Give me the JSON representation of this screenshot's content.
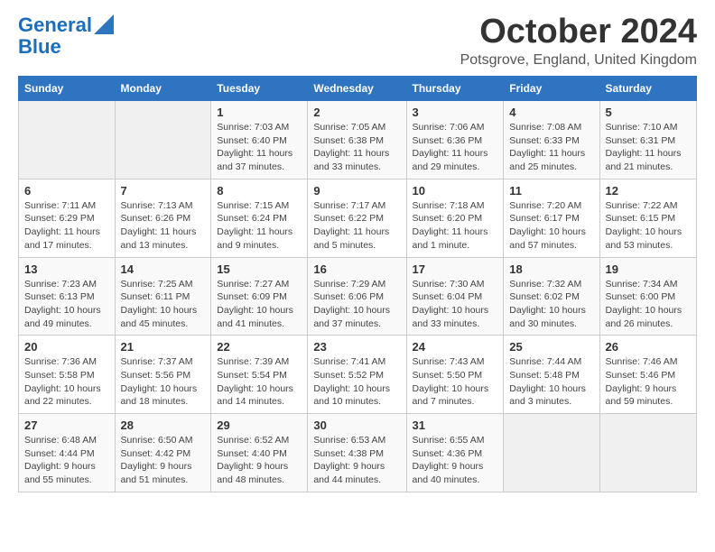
{
  "logo": {
    "line1": "General",
    "line2": "Blue"
  },
  "header": {
    "month_title": "October 2024",
    "location": "Potsgrove, England, United Kingdom"
  },
  "days_of_week": [
    "Sunday",
    "Monday",
    "Tuesday",
    "Wednesday",
    "Thursday",
    "Friday",
    "Saturday"
  ],
  "weeks": [
    [
      {
        "day": "",
        "info": ""
      },
      {
        "day": "",
        "info": ""
      },
      {
        "day": "1",
        "info": "Sunrise: 7:03 AM\nSunset: 6:40 PM\nDaylight: 11 hours and 37 minutes."
      },
      {
        "day": "2",
        "info": "Sunrise: 7:05 AM\nSunset: 6:38 PM\nDaylight: 11 hours and 33 minutes."
      },
      {
        "day": "3",
        "info": "Sunrise: 7:06 AM\nSunset: 6:36 PM\nDaylight: 11 hours and 29 minutes."
      },
      {
        "day": "4",
        "info": "Sunrise: 7:08 AM\nSunset: 6:33 PM\nDaylight: 11 hours and 25 minutes."
      },
      {
        "day": "5",
        "info": "Sunrise: 7:10 AM\nSunset: 6:31 PM\nDaylight: 11 hours and 21 minutes."
      }
    ],
    [
      {
        "day": "6",
        "info": "Sunrise: 7:11 AM\nSunset: 6:29 PM\nDaylight: 11 hours and 17 minutes."
      },
      {
        "day": "7",
        "info": "Sunrise: 7:13 AM\nSunset: 6:26 PM\nDaylight: 11 hours and 13 minutes."
      },
      {
        "day": "8",
        "info": "Sunrise: 7:15 AM\nSunset: 6:24 PM\nDaylight: 11 hours and 9 minutes."
      },
      {
        "day": "9",
        "info": "Sunrise: 7:17 AM\nSunset: 6:22 PM\nDaylight: 11 hours and 5 minutes."
      },
      {
        "day": "10",
        "info": "Sunrise: 7:18 AM\nSunset: 6:20 PM\nDaylight: 11 hours and 1 minute."
      },
      {
        "day": "11",
        "info": "Sunrise: 7:20 AM\nSunset: 6:17 PM\nDaylight: 10 hours and 57 minutes."
      },
      {
        "day": "12",
        "info": "Sunrise: 7:22 AM\nSunset: 6:15 PM\nDaylight: 10 hours and 53 minutes."
      }
    ],
    [
      {
        "day": "13",
        "info": "Sunrise: 7:23 AM\nSunset: 6:13 PM\nDaylight: 10 hours and 49 minutes."
      },
      {
        "day": "14",
        "info": "Sunrise: 7:25 AM\nSunset: 6:11 PM\nDaylight: 10 hours and 45 minutes."
      },
      {
        "day": "15",
        "info": "Sunrise: 7:27 AM\nSunset: 6:09 PM\nDaylight: 10 hours and 41 minutes."
      },
      {
        "day": "16",
        "info": "Sunrise: 7:29 AM\nSunset: 6:06 PM\nDaylight: 10 hours and 37 minutes."
      },
      {
        "day": "17",
        "info": "Sunrise: 7:30 AM\nSunset: 6:04 PM\nDaylight: 10 hours and 33 minutes."
      },
      {
        "day": "18",
        "info": "Sunrise: 7:32 AM\nSunset: 6:02 PM\nDaylight: 10 hours and 30 minutes."
      },
      {
        "day": "19",
        "info": "Sunrise: 7:34 AM\nSunset: 6:00 PM\nDaylight: 10 hours and 26 minutes."
      }
    ],
    [
      {
        "day": "20",
        "info": "Sunrise: 7:36 AM\nSunset: 5:58 PM\nDaylight: 10 hours and 22 minutes."
      },
      {
        "day": "21",
        "info": "Sunrise: 7:37 AM\nSunset: 5:56 PM\nDaylight: 10 hours and 18 minutes."
      },
      {
        "day": "22",
        "info": "Sunrise: 7:39 AM\nSunset: 5:54 PM\nDaylight: 10 hours and 14 minutes."
      },
      {
        "day": "23",
        "info": "Sunrise: 7:41 AM\nSunset: 5:52 PM\nDaylight: 10 hours and 10 minutes."
      },
      {
        "day": "24",
        "info": "Sunrise: 7:43 AM\nSunset: 5:50 PM\nDaylight: 10 hours and 7 minutes."
      },
      {
        "day": "25",
        "info": "Sunrise: 7:44 AM\nSunset: 5:48 PM\nDaylight: 10 hours and 3 minutes."
      },
      {
        "day": "26",
        "info": "Sunrise: 7:46 AM\nSunset: 5:46 PM\nDaylight: 9 hours and 59 minutes."
      }
    ],
    [
      {
        "day": "27",
        "info": "Sunrise: 6:48 AM\nSunset: 4:44 PM\nDaylight: 9 hours and 55 minutes."
      },
      {
        "day": "28",
        "info": "Sunrise: 6:50 AM\nSunset: 4:42 PM\nDaylight: 9 hours and 51 minutes."
      },
      {
        "day": "29",
        "info": "Sunrise: 6:52 AM\nSunset: 4:40 PM\nDaylight: 9 hours and 48 minutes."
      },
      {
        "day": "30",
        "info": "Sunrise: 6:53 AM\nSunset: 4:38 PM\nDaylight: 9 hours and 44 minutes."
      },
      {
        "day": "31",
        "info": "Sunrise: 6:55 AM\nSunset: 4:36 PM\nDaylight: 9 hours and 40 minutes."
      },
      {
        "day": "",
        "info": ""
      },
      {
        "day": "",
        "info": ""
      }
    ]
  ]
}
